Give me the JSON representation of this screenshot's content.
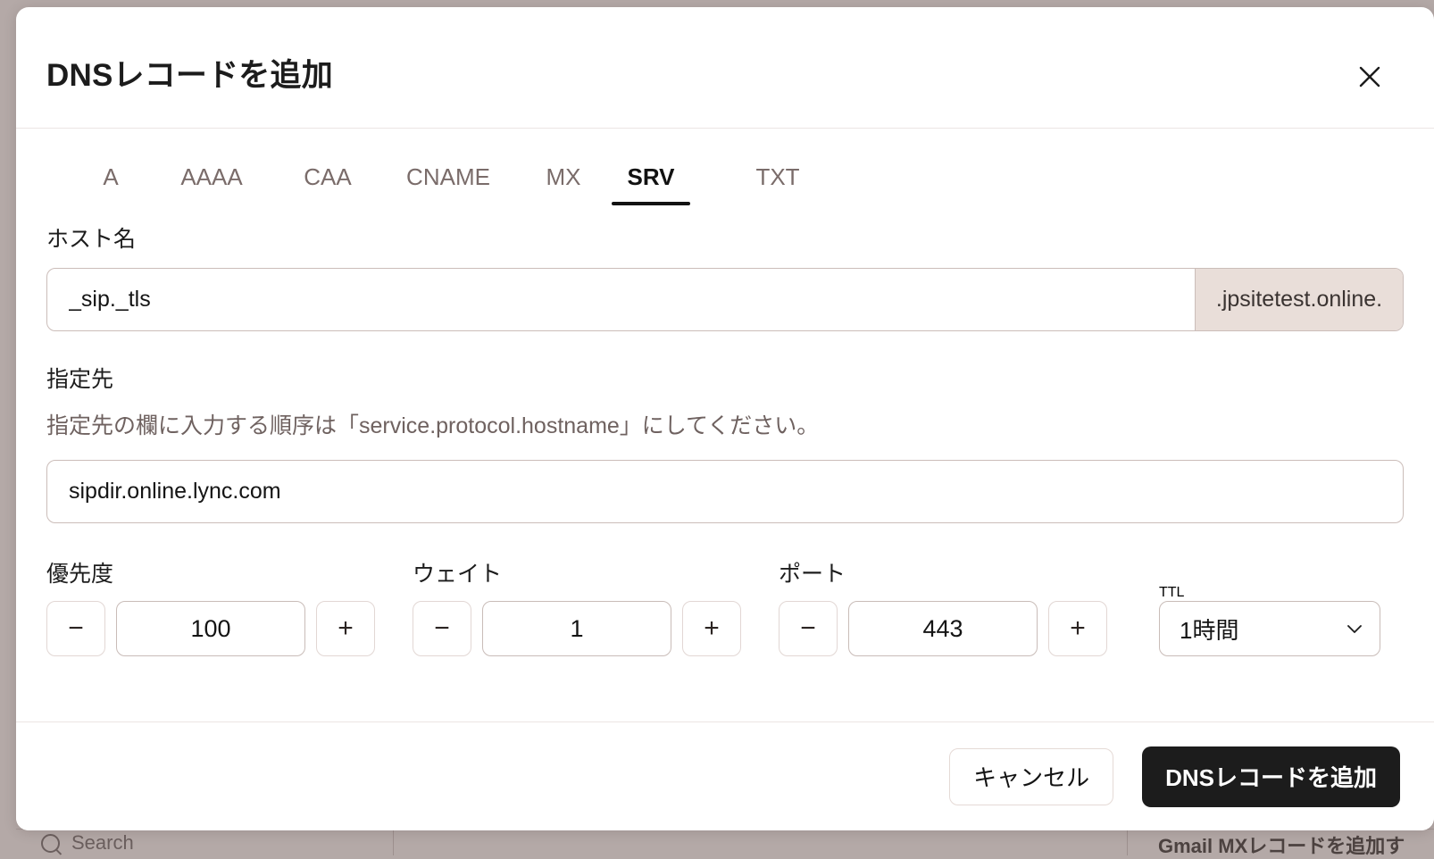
{
  "backdrop": {
    "search_placeholder": "Search",
    "right_text": "Gmail MXレコードを追加す"
  },
  "modal": {
    "title": "DNSレコードを追加",
    "close_label": "×",
    "tabs": [
      {
        "label": "A",
        "active": false
      },
      {
        "label": "AAAA",
        "active": false
      },
      {
        "label": "CAA",
        "active": false
      },
      {
        "label": "CNAME",
        "active": false
      },
      {
        "label": "MX",
        "active": false
      },
      {
        "label": "SRV",
        "active": true
      },
      {
        "label": "TXT",
        "active": false
      }
    ],
    "host": {
      "label": "ホスト名",
      "value": "_sip._tls",
      "placeholder": "",
      "suffix": ".jpsitetest.online."
    },
    "destination": {
      "label": "指定先",
      "hint": "指定先の欄に入力する順序は「service.protocol.hostname」にしてください。",
      "value": "sipdir.online.lync.com",
      "placeholder": ""
    },
    "numbers": [
      {
        "label": "優先度",
        "value": "100",
        "minus": "−",
        "plus": "+"
      },
      {
        "label": "ウェイト",
        "value": "1",
        "minus": "−",
        "plus": "+"
      },
      {
        "label": "ポート",
        "value": "443",
        "minus": "−",
        "plus": "+"
      }
    ],
    "ttl": {
      "label": "TTL",
      "value": "1時間"
    },
    "footer": {
      "cancel_label": "キャンセル",
      "submit_label": "DNSレコードを追加"
    }
  },
  "colors": {
    "backdrop": "#b4a9a7",
    "accent_dark": "#1c1c1c",
    "suffix_bg": "#e9ded9",
    "border": "#cbbdb9"
  }
}
